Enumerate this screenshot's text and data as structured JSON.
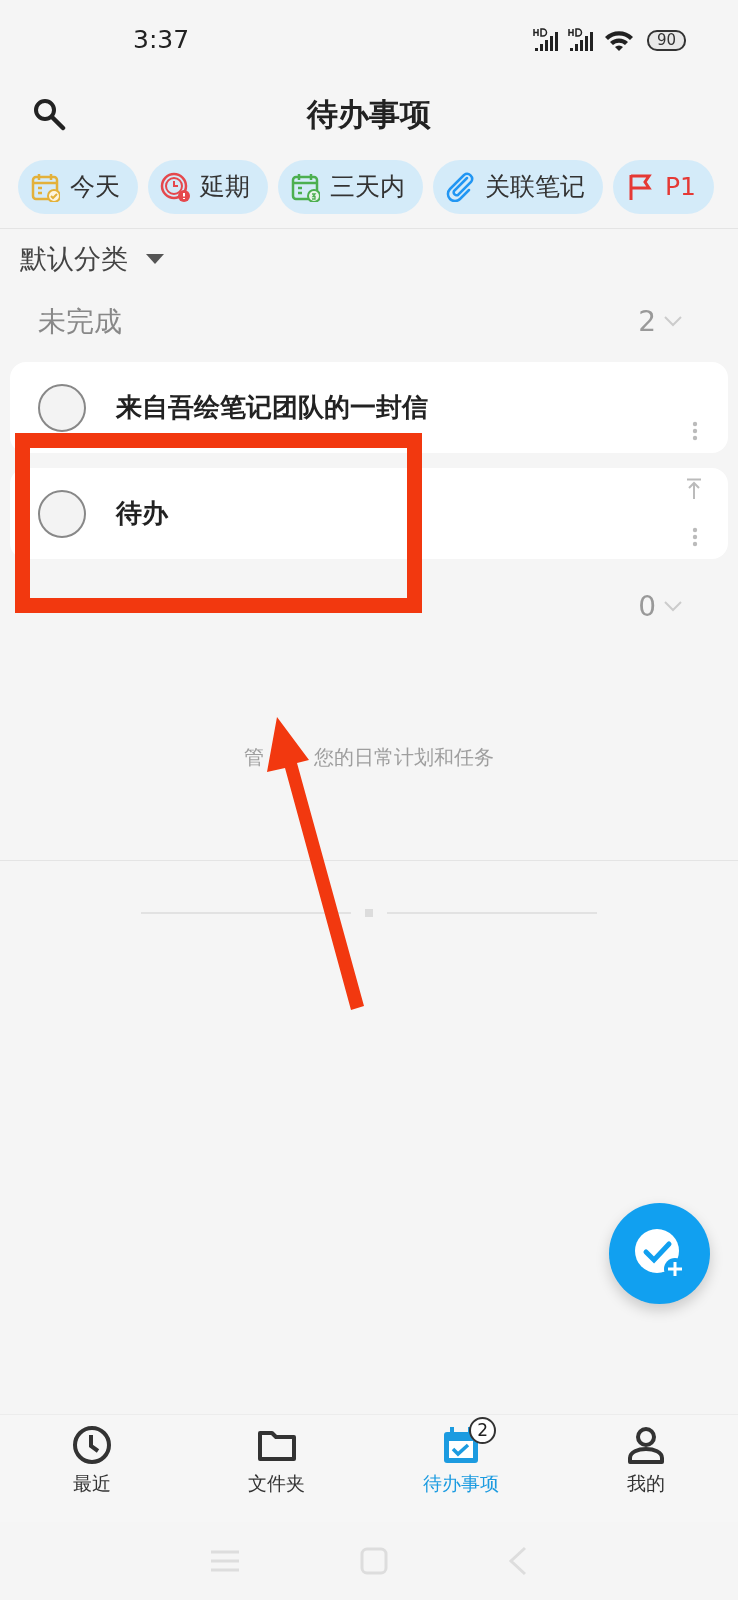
{
  "status_bar": {
    "time": "3:37",
    "battery": "90"
  },
  "header": {
    "title": "待办事项"
  },
  "filter_chips": [
    {
      "kind": "today",
      "label": "今天"
    },
    {
      "kind": "overdue",
      "label": "延期"
    },
    {
      "kind": "threedays",
      "label": "三天内"
    },
    {
      "kind": "linked",
      "label": "关联笔记"
    },
    {
      "kind": "priority",
      "label": "P1"
    }
  ],
  "category": {
    "label": "默认分类"
  },
  "sections": [
    {
      "title": "未完成",
      "count": "2",
      "tasks": [
        {
          "title": "来自吾绘笔记团队的一封信",
          "checked": false,
          "top_button": false
        },
        {
          "title": "待办",
          "checked": false,
          "top_button": true
        }
      ]
    },
    {
      "count": "0"
    }
  ],
  "empty_hint": [
    "管",
    "您的日常计划和任务"
  ],
  "bottom_nav": [
    {
      "kind": "recent",
      "label": "最近",
      "selected": false
    },
    {
      "kind": "folder",
      "label": "文件夹",
      "selected": false
    },
    {
      "kind": "todo",
      "label": "待办事项",
      "selected": true,
      "badge": "2"
    },
    {
      "kind": "me",
      "label": "我的",
      "selected": false
    }
  ]
}
